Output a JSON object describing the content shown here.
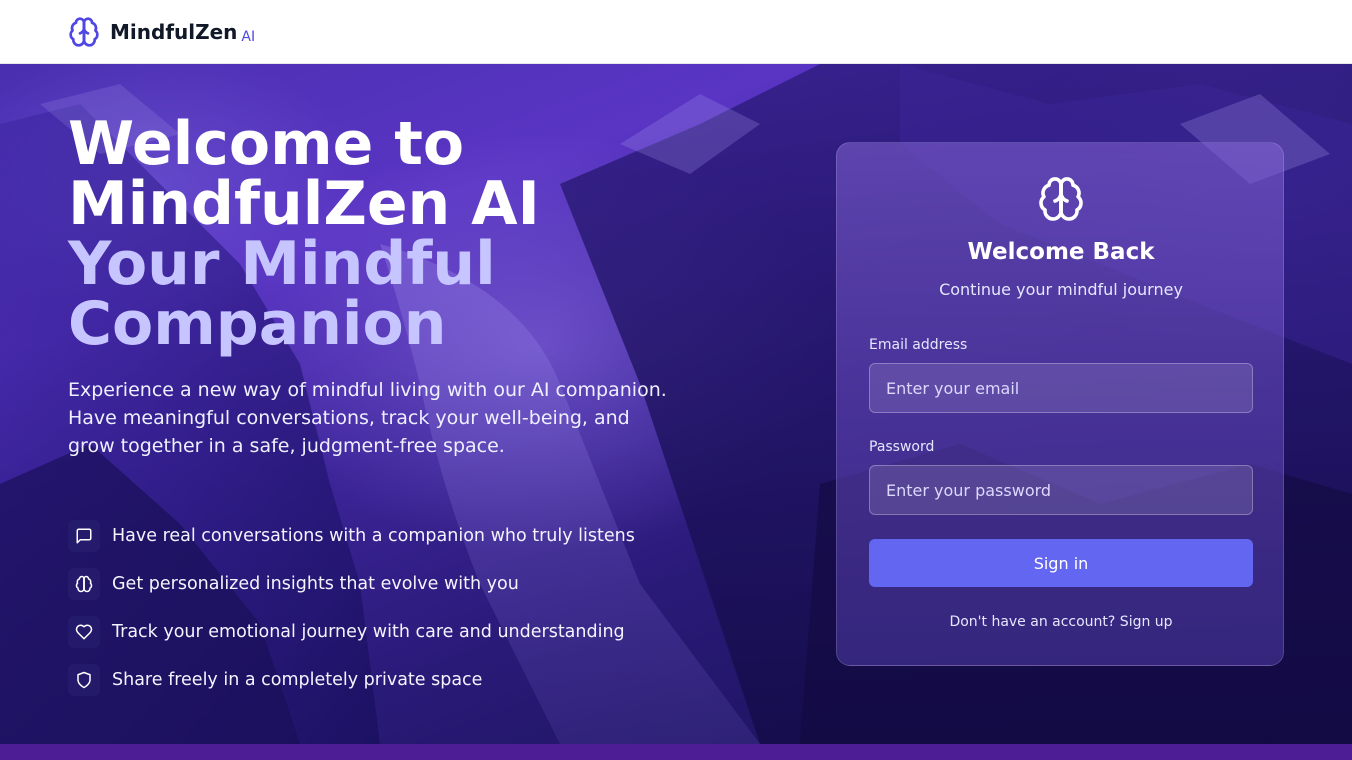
{
  "header": {
    "brand_name": "MindfulZen",
    "brand_suffix": "AI"
  },
  "hero": {
    "headline_line1": "Welcome to",
    "headline_line2": "MindfulZen AI",
    "headline_accent_line1": "Your Mindful",
    "headline_accent_line2": "Companion",
    "description": "Experience a new way of mindful living with our AI companion. Have meaningful conversations, track your well-being, and grow together in a safe, judgment-free space.",
    "features": [
      {
        "icon": "message-square-icon",
        "text": "Have real conversations with a companion who truly listens"
      },
      {
        "icon": "brain-icon",
        "text": "Get personalized insights that evolve with you"
      },
      {
        "icon": "heart-icon",
        "text": "Track your emotional journey with care and understanding"
      },
      {
        "icon": "shield-icon",
        "text": "Share freely in a completely private space"
      }
    ]
  },
  "login": {
    "title": "Welcome Back",
    "subtitle": "Continue your mindful journey",
    "email_label": "Email address",
    "email_placeholder": "Enter your email",
    "email_value": "",
    "password_label": "Password",
    "password_placeholder": "Enter your password",
    "password_value": "",
    "signin_label": "Sign in",
    "signup_text": "Don't have an account? Sign up"
  },
  "colors": {
    "accent": "#6366f1",
    "brand": "#4f46e5",
    "headline_accent": "#c7c5ff",
    "footer_band": "#4c1d95"
  }
}
